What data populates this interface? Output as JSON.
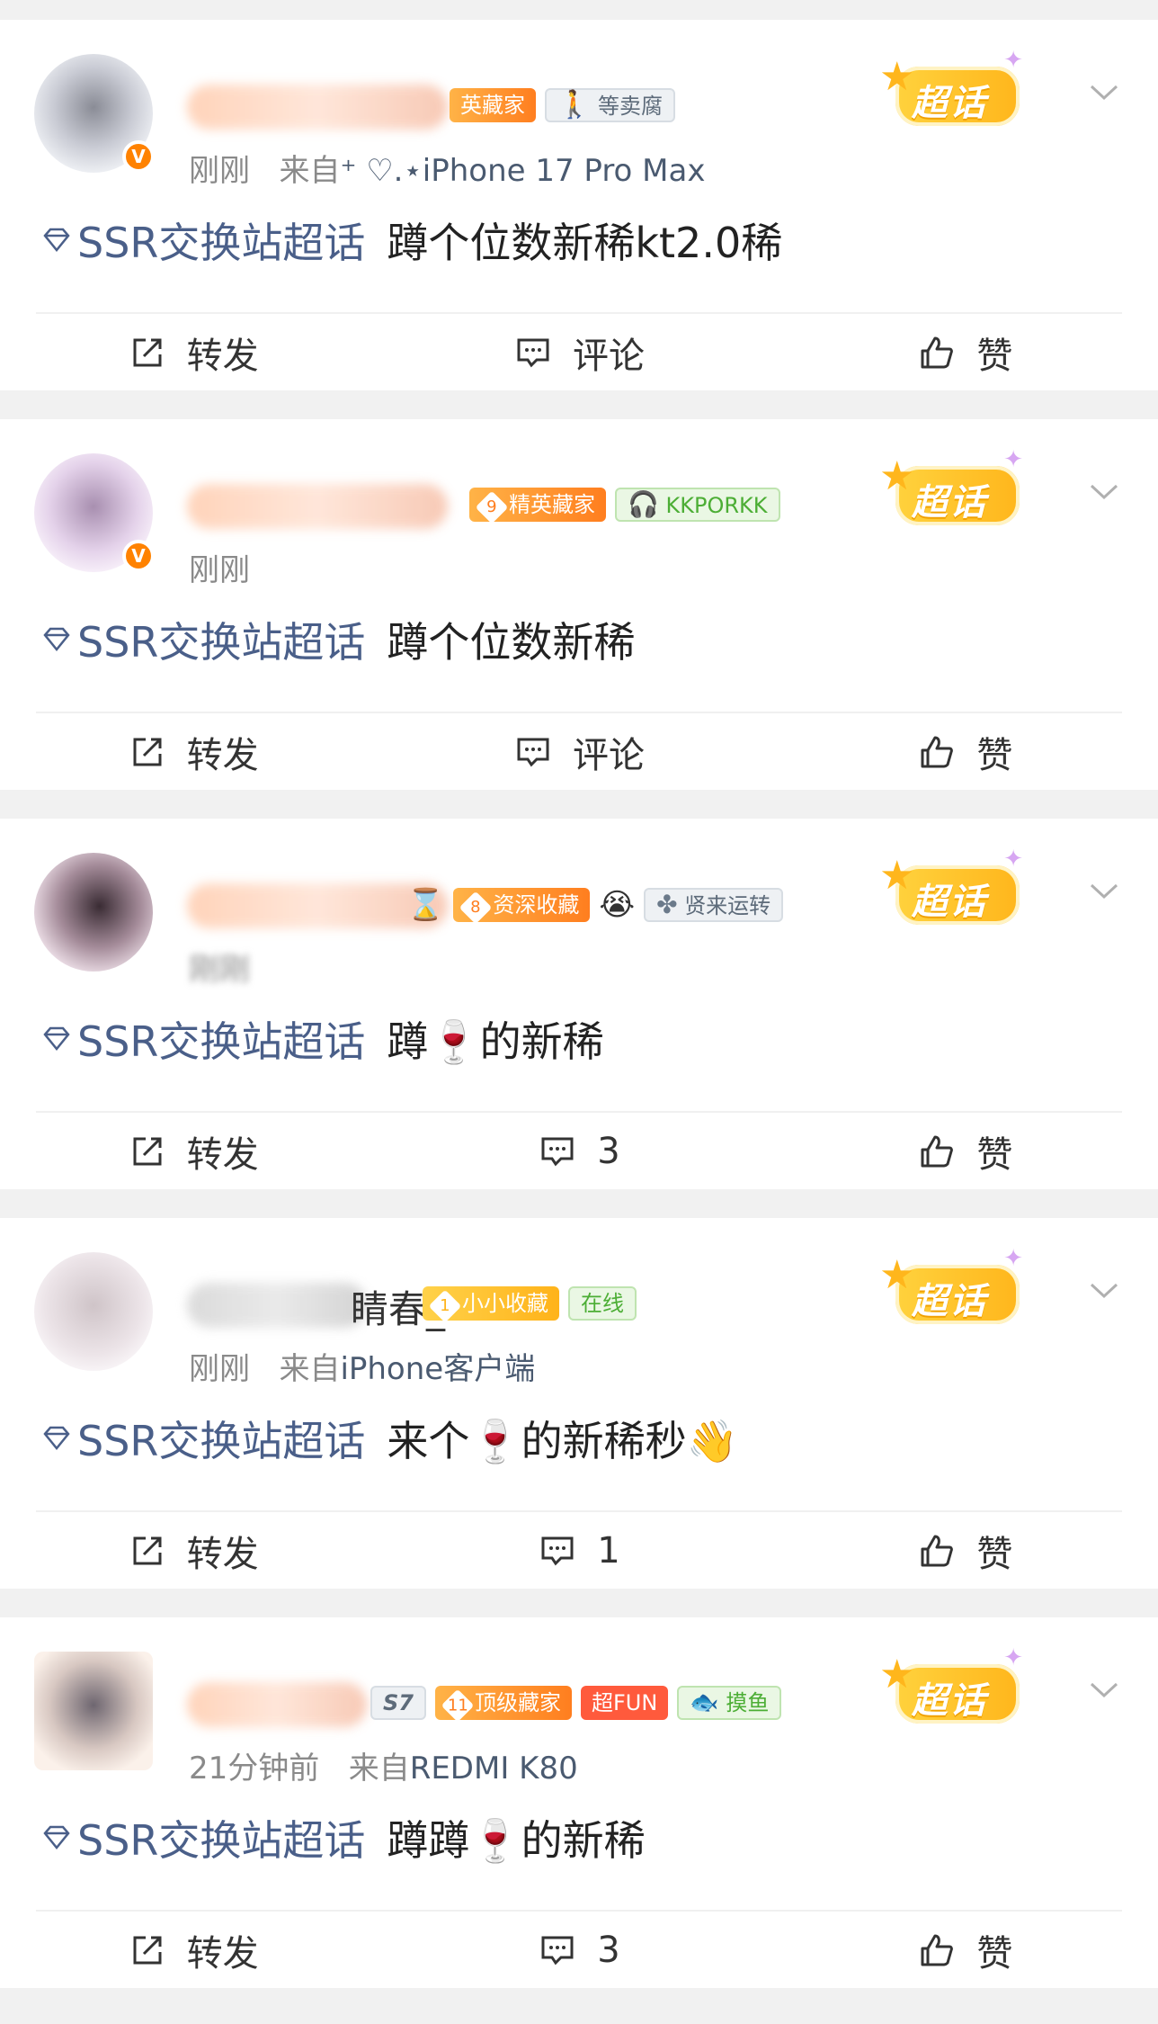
{
  "chaohua_label": "超话",
  "topic_label": "SSR交换站超话",
  "posts": [
    {
      "badges": [
        {
          "text": "英藏家",
          "style": "orange"
        },
        {
          "text": "等卖腐",
          "style": "grey",
          "icon": "person-icon"
        }
      ],
      "meta": {
        "time": "刚刚",
        "source_prefix": "来自",
        "source": "⁺ ♡.⋆iPhone 17 Pro Max"
      },
      "text": "蹲个位数新稀kt2.0稀",
      "actions": {
        "repost": "转发",
        "comment": "评论",
        "like": "赞"
      }
    },
    {
      "badges": [
        {
          "text": "精英藏家",
          "style": "orange",
          "num": "9"
        },
        {
          "text": "KKPORKK",
          "style": "green",
          "icon": "headphones-icon"
        }
      ],
      "meta": {
        "time": "刚刚",
        "source_prefix": "",
        "source": ""
      },
      "text": "蹲个位数新稀",
      "actions": {
        "repost": "转发",
        "comment": "评论",
        "like": "赞"
      }
    },
    {
      "badges": [
        {
          "text": "资深收藏",
          "style": "orange",
          "num": "8"
        },
        {
          "text": "贤来运转",
          "style": "grey",
          "icon": "clover-icon"
        }
      ],
      "meta": {
        "time": "刚刚",
        "source_prefix": "",
        "source": ""
      },
      "text": "蹲🍷的新稀",
      "actions": {
        "repost": "转发",
        "comment": "3",
        "like": "赞"
      }
    },
    {
      "name": "睛春_",
      "badges": [
        {
          "text": "小小收藏",
          "style": "yellow",
          "num": "1"
        },
        {
          "text": "在线",
          "style": "green"
        }
      ],
      "meta": {
        "time": "刚刚",
        "source_prefix": "来自",
        "source": "iPhone客户端"
      },
      "text": "来个🍷的新稀秒👋",
      "actions": {
        "repost": "转发",
        "comment": "1",
        "like": "赞"
      }
    },
    {
      "badges": [
        {
          "text": "S7",
          "style": "grey"
        },
        {
          "text": "顶级藏家",
          "style": "orange",
          "num": "11"
        },
        {
          "text": "超FUN",
          "style": "red"
        },
        {
          "text": "摸鱼",
          "style": "green",
          "icon": "fish-icon"
        }
      ],
      "meta": {
        "time": "21分钟前",
        "source_prefix": "来自",
        "source": "REDMI K80"
      },
      "text": "蹲蹲🍷的新稀",
      "actions": {
        "repost": "转发",
        "comment": "3",
        "like": "赞"
      }
    }
  ]
}
